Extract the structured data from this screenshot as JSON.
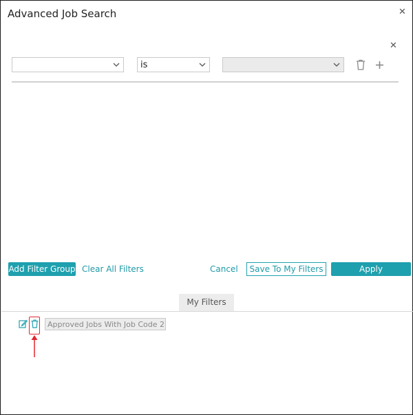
{
  "dialog": {
    "title": "Advanced Job Search"
  },
  "filter_row": {
    "field_value": "",
    "operator_value": "is",
    "value_value": ""
  },
  "actions": {
    "add_filter_group": "Add Filter Group",
    "clear_all": "Clear All Filters",
    "cancel": "Cancel",
    "save_to_my_filters": "Save To My Filters",
    "apply": "Apply"
  },
  "my_filters": {
    "tab_label": "My Filters",
    "items": [
      {
        "name": "Approved Jobs With Job Code 2("
      }
    ]
  },
  "colors": {
    "accent": "#1fa0ae",
    "highlight": "#e0262e"
  }
}
